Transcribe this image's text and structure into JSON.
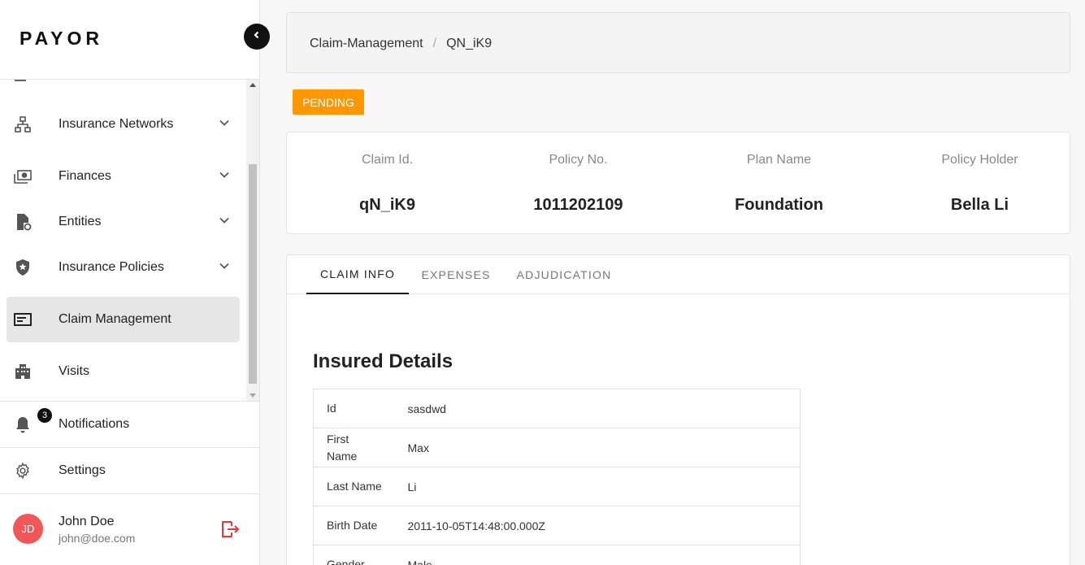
{
  "app": {
    "logo": "PAYOR"
  },
  "sidebar": {
    "items": [
      {
        "label": "Insurance Networks",
        "icon": "network-icon",
        "has_children": true
      },
      {
        "label": "Finances",
        "icon": "money-icon",
        "has_children": true
      },
      {
        "label": "Entities",
        "icon": "entity-file-icon",
        "has_children": true
      },
      {
        "label": "Insurance Policies",
        "icon": "shield-star-icon",
        "has_children": true
      },
      {
        "label": "Claim Management",
        "icon": "card-icon",
        "active": true
      },
      {
        "label": "Visits",
        "icon": "building-icon"
      }
    ],
    "notifications": {
      "label": "Notifications",
      "count": "3"
    },
    "settings": {
      "label": "Settings"
    },
    "user": {
      "initials": "JD",
      "name": "John Doe",
      "email": "john@doe.com"
    }
  },
  "breadcrumb": {
    "parent": "Claim-Management",
    "separator": "/",
    "current": "QN_iK9"
  },
  "status": {
    "label": "PENDING",
    "color": "#ff9800"
  },
  "summary": [
    {
      "label": "Claim Id.",
      "value": "qN_iK9"
    },
    {
      "label": "Policy No.",
      "value": "1011202109"
    },
    {
      "label": "Plan Name",
      "value": "Foundation"
    },
    {
      "label": "Policy Holder",
      "value": "Bella Li"
    }
  ],
  "tabs": [
    {
      "label": "CLAIM INFO",
      "active": true
    },
    {
      "label": "EXPENSES"
    },
    {
      "label": "ADJUDICATION"
    }
  ],
  "insured": {
    "title": "Insured Details",
    "rows": [
      {
        "key": "Id",
        "value": "sasdwd"
      },
      {
        "key": "First Name",
        "value": "Max"
      },
      {
        "key": "Last Name",
        "value": "Li"
      },
      {
        "key": "Birth Date",
        "value": "2011-10-05T14:48:00.000Z"
      },
      {
        "key": "Gender",
        "value": "Male"
      }
    ]
  },
  "colors": {
    "accent": "#111111",
    "pending": "#ff9800",
    "avatar": "#f25757",
    "logout": "#e53935"
  }
}
